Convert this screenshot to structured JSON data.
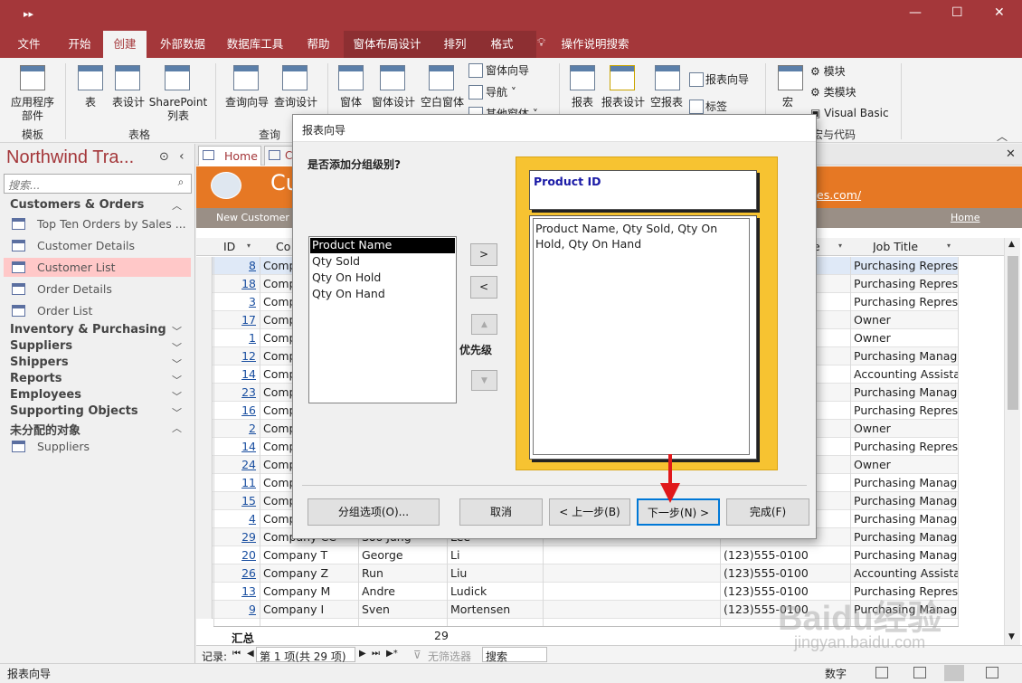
{
  "window": {
    "quick_access": "▸▸",
    "minimize": "—",
    "maximize": "☐",
    "close": "✕"
  },
  "ribbon_tabs": [
    "文件",
    "开始",
    "创建",
    "外部数据",
    "数据库工具",
    "帮助",
    "窗体布局设计",
    "排列",
    "格式"
  ],
  "ribbon_search": "操作说明搜索",
  "ribbon": {
    "templates": {
      "label": "应用程序\n部件",
      "group": "模板"
    },
    "tables": {
      "table": "表",
      "table_design": "表设计",
      "sharepoint": "SharePoint\n列表",
      "group": "表格"
    },
    "queries": {
      "wizard": "查询向导",
      "design": "查询设计",
      "group": "查询"
    },
    "forms": {
      "form": "窗体",
      "form_design": "窗体设计",
      "blank_form": "空白窗体",
      "form_wizard": "窗体向导",
      "navigation": "导航",
      "more_forms": "其他窗体"
    },
    "reports": {
      "report": "报表",
      "report_design": "报表设计",
      "blank_report": "空报表",
      "report_wizard": "报表向导",
      "labels": "标签"
    },
    "macros": {
      "macro": "宏",
      "module": "模块",
      "class_module": "类模块",
      "vb": "Visual Basic",
      "group": "宏与代码"
    }
  },
  "nav": {
    "title": "Northwind Tra...",
    "search_placeholder": "搜索...",
    "groups": [
      {
        "label": "Customers & Orders",
        "items": [
          "Top Ten Orders by Sales ...",
          "Customer Details",
          "Customer List",
          "Order Details",
          "Order List"
        ]
      },
      {
        "label": "Inventory & Purchasing"
      },
      {
        "label": "Suppliers"
      },
      {
        "label": "Shippers"
      },
      {
        "label": "Reports"
      },
      {
        "label": "Employees"
      },
      {
        "label": "Supporting Objects"
      },
      {
        "label": "未分配的对象",
        "items": [
          "Suppliers"
        ]
      }
    ]
  },
  "doc_tabs": [
    "Home",
    "C"
  ],
  "form_header": {
    "title": "Cu",
    "link": "es.com/",
    "new_customer": "New Customer",
    "home": "Home"
  },
  "grid": {
    "headers": [
      "ID",
      "Co",
      "",
      "",
      "e",
      "Job Title"
    ],
    "rows": [
      {
        "id": "8",
        "company": "Comp",
        "first": "",
        "last": "",
        "phone": "",
        "job": "Purchasing Represe"
      },
      {
        "id": "18",
        "company": "Comp",
        "first": "",
        "last": "",
        "phone": "",
        "job": "Purchasing Represe"
      },
      {
        "id": "3",
        "company": "Comp",
        "first": "",
        "last": "",
        "phone": "",
        "job": "Purchasing Represe"
      },
      {
        "id": "17",
        "company": "Comp",
        "first": "",
        "last": "",
        "phone": "",
        "job": "Owner"
      },
      {
        "id": "1",
        "company": "Comp",
        "first": "",
        "last": "",
        "phone": "",
        "job": "Owner"
      },
      {
        "id": "12",
        "company": "Comp",
        "first": "",
        "last": "",
        "phone": "",
        "job": "Purchasing Manage"
      },
      {
        "id": "14",
        "company": "Comp",
        "first": "",
        "last": "",
        "phone": "",
        "job": "Accounting Assista"
      },
      {
        "id": "23",
        "company": "Comp",
        "first": "",
        "last": "",
        "phone": "",
        "job": "Purchasing Manage"
      },
      {
        "id": "16",
        "company": "Comp",
        "first": "",
        "last": "",
        "phone": "",
        "job": "Purchasing Represe"
      },
      {
        "id": "2",
        "company": "Comp",
        "first": "",
        "last": "",
        "phone": "",
        "job": "Owner"
      },
      {
        "id": "14",
        "company": "Comp",
        "first": "",
        "last": "",
        "phone": "",
        "job": "Purchasing Represe"
      },
      {
        "id": "24",
        "company": "Comp",
        "first": "",
        "last": "",
        "phone": "",
        "job": "Owner"
      },
      {
        "id": "11",
        "company": "Comp",
        "first": "",
        "last": "",
        "phone": "",
        "job": "Purchasing Manage"
      },
      {
        "id": "15",
        "company": "Comp",
        "first": "",
        "last": "",
        "phone": "",
        "job": "Purchasing Manage"
      },
      {
        "id": "4",
        "company": "Comp",
        "first": "",
        "last": "",
        "phone": "",
        "job": "Purchasing Manage"
      },
      {
        "id": "29",
        "company": "Company CC",
        "first": "Soo Jung",
        "last": "Lee",
        "phone": "",
        "job": "Purchasing Manage"
      },
      {
        "id": "20",
        "company": "Company T",
        "first": "George",
        "last": "Li",
        "phone": "(123)555-0100",
        "job": "Purchasing Manage"
      },
      {
        "id": "26",
        "company": "Company Z",
        "first": "Run",
        "last": "Liu",
        "phone": "(123)555-0100",
        "job": "Accounting Assista"
      },
      {
        "id": "13",
        "company": "Company M",
        "first": "Andre",
        "last": "Ludick",
        "phone": "(123)555-0100",
        "job": "Purchasing Represe"
      },
      {
        "id": "9",
        "company": "Company I",
        "first": "Sven",
        "last": "Mortensen",
        "phone": "(123)555-0100",
        "job": "Purchasing Manage"
      }
    ],
    "total_label": "汇总",
    "total_value": "29"
  },
  "record_nav": {
    "label": "记录:",
    "position": "第 1 项(共 29 项)",
    "filter": "无筛选器",
    "search": "搜索"
  },
  "status": {
    "left": "报表向导",
    "right": "数字"
  },
  "dialog": {
    "title": "报表向导",
    "question": "是否添加分组级别?",
    "fields": [
      "Product Name",
      "Qty Sold",
      "Qty On Hold",
      "Qty On Hand"
    ],
    "selected_field": "Product Name",
    "add_btn": ">",
    "remove_btn": "<",
    "priority_label": "优先级",
    "up_btn": "▲",
    "down_btn": "▼",
    "preview_group": "Product ID",
    "preview_fields": "Product Name, Qty Sold, Qty On Hold, Qty On Hand",
    "buttons": {
      "group_options": "分组选项(O)...",
      "cancel": "取消",
      "back": "< 上一步(B)",
      "next": "下一步(N) >",
      "finish": "完成(F)"
    }
  },
  "watermark": {
    "brand": "Baidu经验",
    "url": "jingyan.baidu.com"
  },
  "colors": {
    "accent": "#a4373a",
    "form_header": "#e67824",
    "selection": "#ffc8c8",
    "preview_frame": "#f7c331",
    "annotation_arrow": "#e0181b"
  }
}
